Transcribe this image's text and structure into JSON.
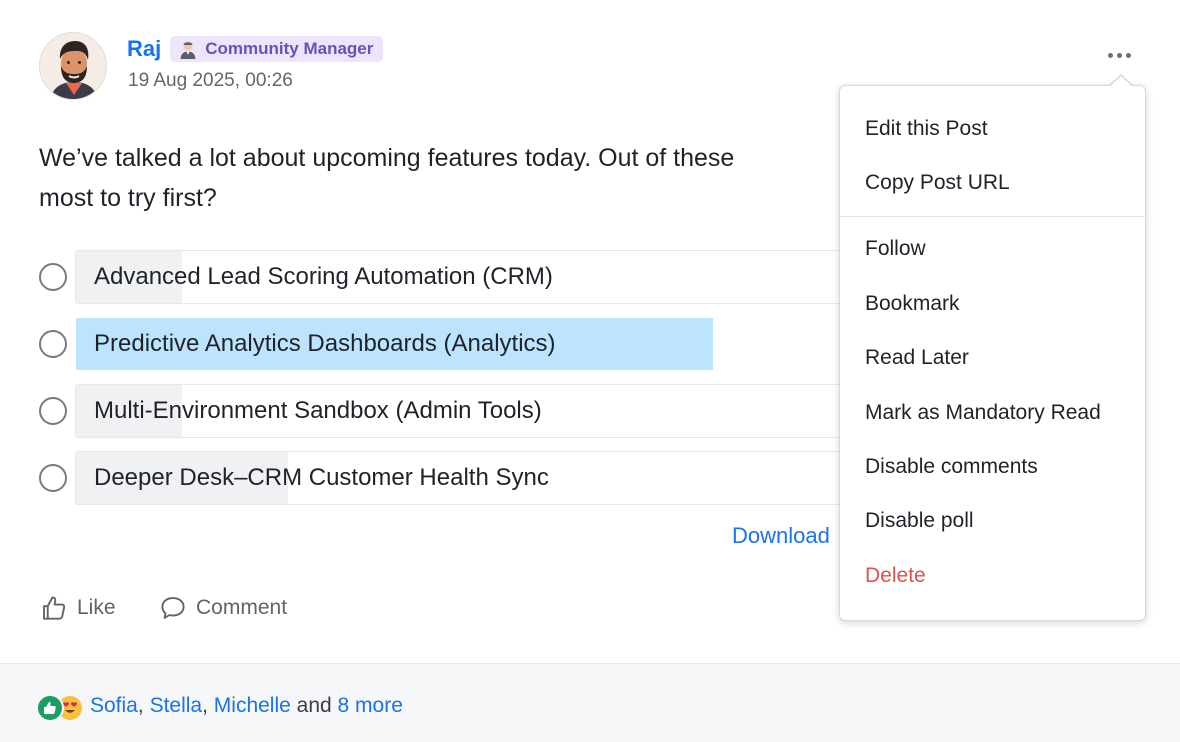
{
  "post": {
    "author": {
      "name": "Raj",
      "role": "Community Manager"
    },
    "timestamp": "19 Aug 2025, 00:26",
    "text": "We’ve talked a lot about upcoming features today. Out of these",
    "text_line2": "most to try first?",
    "poll": {
      "options": [
        {
          "label": "Advanced Lead Scoring Automation (CRM)",
          "share": 0.1,
          "selected": false
        },
        {
          "label": "Predictive Analytics Dashboards (Analytics)",
          "share": 0.6,
          "selected": true
        },
        {
          "label": "Multi-Environment Sandbox (Admin Tools)",
          "share": 0.1,
          "selected": false
        },
        {
          "label": "Deeper Desk–CRM Customer Health Sync",
          "share": 0.2,
          "selected": false
        }
      ],
      "download_label": "Download"
    },
    "actions": {
      "like_label": "Like",
      "comment_label": "Comment"
    }
  },
  "reactions": {
    "names": [
      "Sofia",
      "Stella",
      "Michelle"
    ],
    "sep": ",",
    "and_text": "and",
    "more_label": "8 more"
  },
  "menu": {
    "items": [
      "Edit this Post",
      "Copy Post URL",
      "Follow",
      "Bookmark",
      "Read Later",
      "Mark as Mandatory Read",
      "Disable comments",
      "Disable poll",
      "Delete"
    ]
  },
  "colors": {
    "accent": "#1a73e8",
    "badge_bg": "#ece5fb",
    "badge_text": "#6b4fbb",
    "selected_fill": "#bde4ff",
    "danger": "#d9534f"
  }
}
